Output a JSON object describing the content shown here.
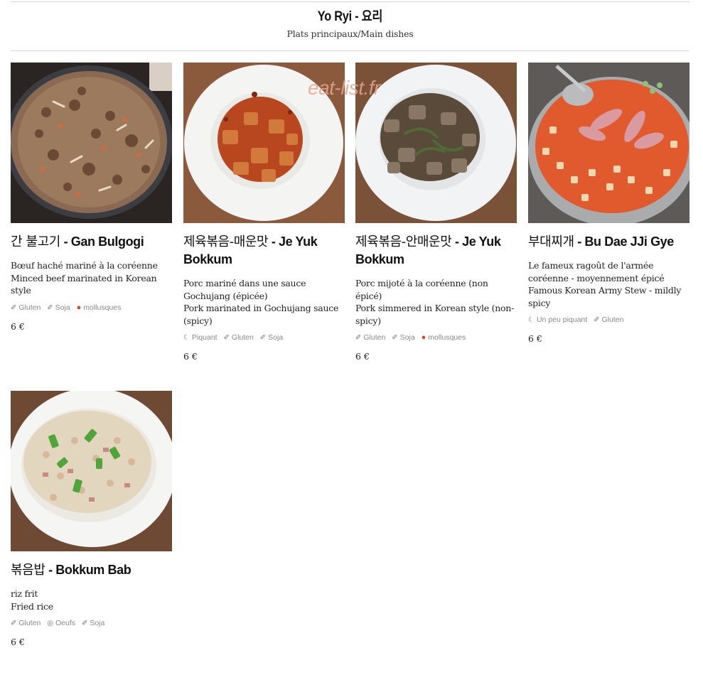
{
  "header": {
    "title": "Yo Ryi - 요리",
    "subtitle": "Plats principaux/Main dishes"
  },
  "watermark": "eat-list.fr",
  "dishes": [
    {
      "name_ko": "간 불고기",
      "name_rest": " - Gan Bulgogi",
      "desc_fr": "Bœuf haché mariné à la coréenne",
      "desc_en": "Minced beef marinated in Korean style",
      "allergens": [
        {
          "icon": "leaf-icon",
          "label": "Gluten"
        },
        {
          "icon": "leaf-icon",
          "label": "Soja"
        },
        {
          "icon": "mollusc-icon",
          "label": "mollusques"
        }
      ],
      "price": "6 €"
    },
    {
      "name_ko": "제육볶음-매운맛",
      "name_rest": " - Je Yuk Bokkum",
      "desc_fr": "Porc mariné dans une sauce Gochujang (épicée)",
      "desc_en": "Pork marinated in Gochujang sauce (spicy)",
      "allergens": [
        {
          "icon": "pepper-icon",
          "label": "Piquant"
        },
        {
          "icon": "leaf-icon",
          "label": "Gluten"
        },
        {
          "icon": "leaf-icon",
          "label": "Soja"
        }
      ],
      "price": "6 €"
    },
    {
      "name_ko": "제육볶음-안매운맛",
      "name_rest": " - Je Yuk Bokkum",
      "desc_fr": "Porc mijoté à la coréenne (non épicé)",
      "desc_en": "Pork simmered in Korean style (non-spicy)",
      "allergens": [
        {
          "icon": "leaf-icon",
          "label": "Gluten"
        },
        {
          "icon": "leaf-icon",
          "label": "Soja"
        },
        {
          "icon": "mollusc-icon",
          "label": "mollusques"
        }
      ],
      "price": "6 €"
    },
    {
      "name_ko": "부대찌개",
      "name_rest": " - Bu Dae JJi Gye",
      "desc_fr": "Le fameux ragoût de l'armée coréenne - moyennement épicé",
      "desc_en": "Famous Korean Army Stew - mildly spicy",
      "allergens": [
        {
          "icon": "pepper-icon",
          "label": "Un peu piquant"
        },
        {
          "icon": "leaf-icon",
          "label": "Gluten"
        }
      ],
      "price": "6 €"
    },
    {
      "name_ko": "볶음밥",
      "name_rest": " - Bokkum Bab",
      "desc_fr": "riz frit",
      "desc_en": "Fried rice",
      "allergens": [
        {
          "icon": "leaf-icon",
          "label": "Gluten"
        },
        {
          "icon": "egg-icon",
          "label": "Oeufs"
        },
        {
          "icon": "leaf-icon",
          "label": "Soja"
        }
      ],
      "price": "6 €"
    }
  ]
}
